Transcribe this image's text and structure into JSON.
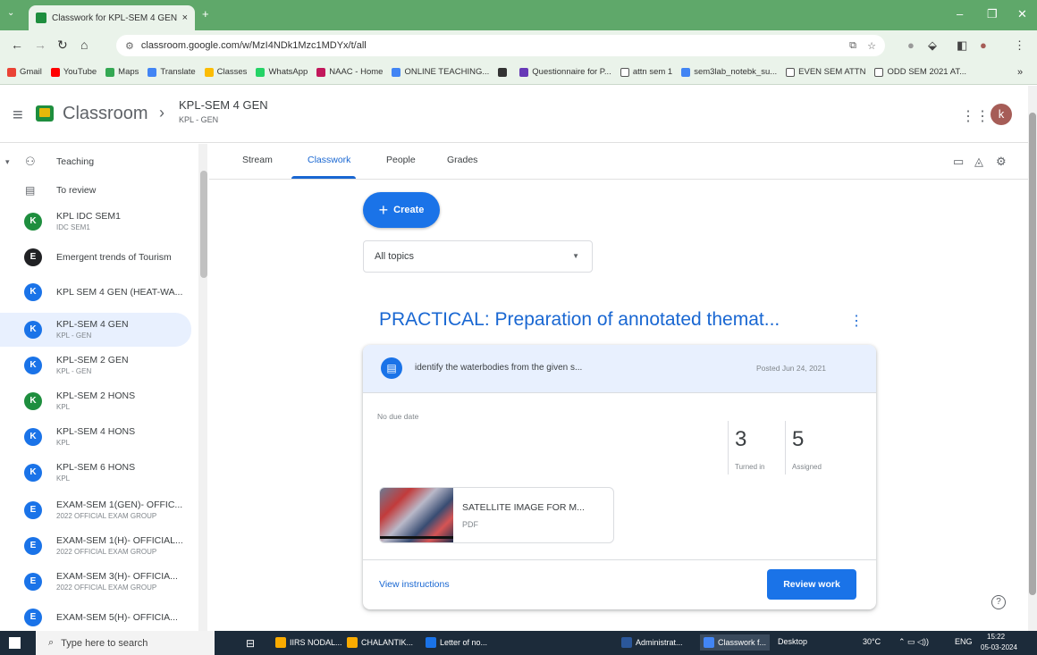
{
  "browser": {
    "tab_title": "Classwork for KPL-SEM 4 GEN",
    "tab_close": "×",
    "new_tab": "+",
    "url": "classroom.google.com/w/MzI4NDk1Mzc1MDYx/t/all",
    "bookmarks": [
      {
        "label": "Gmail",
        "color": "#ea4335"
      },
      {
        "label": "YouTube",
        "color": "#ff0000"
      },
      {
        "label": "Maps",
        "color": "#34a853"
      },
      {
        "label": "Translate",
        "color": "#4285f4"
      },
      {
        "label": "Classes",
        "color": "#fbbc04"
      },
      {
        "label": "WhatsApp",
        "color": "#25d366"
      },
      {
        "label": "NAAC - Home",
        "color": "#c2185b"
      },
      {
        "label": "ONLINE TEACHING...",
        "color": "#4285f4"
      },
      {
        "label": "",
        "color": "#333333"
      },
      {
        "label": "Questionnaire for P...",
        "color": "#673ab7"
      },
      {
        "label": "attn sem 1",
        "color": "#ffffff"
      },
      {
        "label": "sem3lab_notebk_su...",
        "color": "#4285f4"
      },
      {
        "label": "EVEN SEM ATTN",
        "color": "#ffffff"
      },
      {
        "label": "ODD SEM 2021 AT...",
        "color": "#ffffff"
      }
    ],
    "bookmarks_more": "»"
  },
  "header": {
    "app_name": "Classroom",
    "class_title": "KPL-SEM 4 GEN",
    "class_subtitle": "KPL - GEN",
    "avatar_letter": "k"
  },
  "sidebar": {
    "teaching_label": "Teaching",
    "to_review_label": "To review",
    "classes": [
      {
        "letter": "K",
        "name": "KPL IDC SEM1",
        "sub": "IDC SEM1",
        "color": "#1e8e3e"
      },
      {
        "letter": "E",
        "name": "Emergent trends of Tourism",
        "sub": "",
        "color": "#202124"
      },
      {
        "letter": "K",
        "name": "KPL SEM 4 GEN (HEAT-WA...",
        "sub": "",
        "color": "#1a73e8"
      },
      {
        "letter": "K",
        "name": "KPL-SEM 4 GEN",
        "sub": "KPL - GEN",
        "color": "#1a73e8"
      },
      {
        "letter": "K",
        "name": "KPL-SEM 2 GEN",
        "sub": "KPL - GEN",
        "color": "#1a73e8"
      },
      {
        "letter": "K",
        "name": "KPL-SEM 2 HONS",
        "sub": "KPL",
        "color": "#1e8e3e"
      },
      {
        "letter": "K",
        "name": "KPL-SEM 4 HONS",
        "sub": "KPL",
        "color": "#1a73e8"
      },
      {
        "letter": "K",
        "name": "KPL-SEM 6 HONS",
        "sub": "KPL",
        "color": "#1a73e8"
      },
      {
        "letter": "E",
        "name": "EXAM-SEM 1(GEN)- OFFIC...",
        "sub": "2022 OFFICIAL EXAM GROUP",
        "color": "#1a73e8"
      },
      {
        "letter": "E",
        "name": "EXAM-SEM 1(H)- OFFICIAL...",
        "sub": "2022 OFFICIAL EXAM GROUP",
        "color": "#1a73e8"
      },
      {
        "letter": "E",
        "name": "EXAM-SEM 3(H)- OFFICIA...",
        "sub": "2022 OFFICIAL EXAM GROUP",
        "color": "#1a73e8"
      },
      {
        "letter": "E",
        "name": "EXAM-SEM 5(H)- OFFICIA...",
        "sub": "",
        "color": "#1a73e8"
      }
    ]
  },
  "main": {
    "tabs": [
      "Stream",
      "Classwork",
      "People",
      "Grades"
    ],
    "active_tab": "Classwork",
    "create_label": "Create",
    "topics_value": "All topics",
    "topic_title": "PRACTICAL: Preparation of annotated themat...",
    "assignment": {
      "title": "identify the waterbodies from the given s...",
      "posted": "Posted Jun 24, 2021",
      "due": "No due date",
      "turned_in": "3",
      "turned_in_label": "Turned in",
      "assigned": "5",
      "assigned_label": "Assigned",
      "attachment_name": "SATELLITE IMAGE FOR M...",
      "attachment_type": "PDF",
      "view_instructions": "View instructions",
      "review_work": "Review work"
    }
  },
  "taskbar": {
    "search_placeholder": "Type here to search",
    "items": [
      {
        "label": "IIRS NODAL...",
        "color": "#f9ab00"
      },
      {
        "label": "CHALANTIK...",
        "color": "#f9ab00"
      },
      {
        "label": "Letter of no...",
        "color": "#1a73e8"
      },
      {
        "label": "Administrat...",
        "color": "#2b579a"
      },
      {
        "label": "Classwork f...",
        "color": "#4285f4"
      }
    ],
    "desktop_label": "Desktop",
    "temperature": "30°C",
    "language": "ENG",
    "time": "15:22",
    "date": "05-03-2024"
  }
}
